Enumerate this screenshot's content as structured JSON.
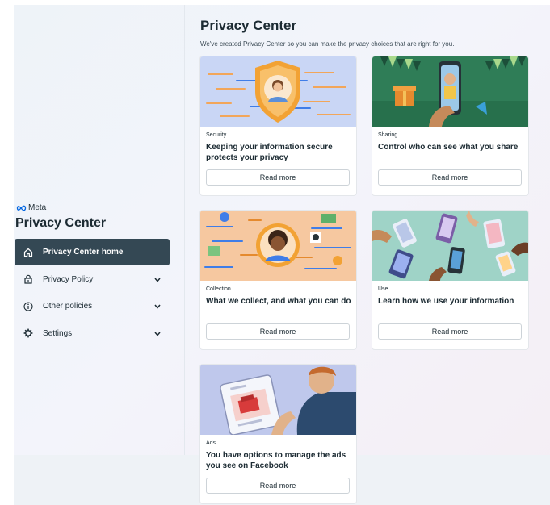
{
  "sidebar": {
    "brand": "Meta",
    "title": "Privacy Center",
    "items": [
      {
        "label": "Privacy Center home",
        "icon": "home-icon"
      },
      {
        "label": "Privacy Policy",
        "icon": "lock-icon"
      },
      {
        "label": "Other policies",
        "icon": "info-icon"
      },
      {
        "label": "Settings",
        "icon": "gear-icon"
      }
    ]
  },
  "main": {
    "title": "Privacy Center",
    "subtitle": "We've created Privacy Center so you can make the privacy choices that are right for you.",
    "cards": [
      {
        "category": "Security",
        "title": "Keeping your information secure protects your privacy",
        "button": "Read more"
      },
      {
        "category": "Sharing",
        "title": "Control who can see what you share",
        "button": "Read more"
      },
      {
        "category": "Collection",
        "title": "What we collect, and what you can do",
        "button": "Read more"
      },
      {
        "category": "Use",
        "title": "Learn how we use your information",
        "button": "Read more"
      },
      {
        "category": "Ads",
        "title": "You have options to manage the ads you see on Facebook",
        "button": "Read more"
      }
    ]
  },
  "colors": {
    "active_nav_bg": "#344854",
    "text_primary": "#1c2b33",
    "meta_blue": "#0668e1"
  }
}
